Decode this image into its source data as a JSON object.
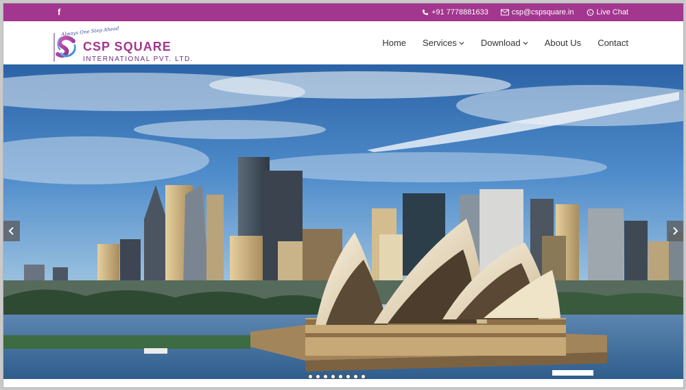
{
  "topbar": {
    "social_icon": "facebook-icon",
    "phone": "+91 7778881633",
    "email": "csp@cspsquare.in",
    "live_chat": "Live Chat",
    "background": "#a3368e"
  },
  "logo": {
    "tagline": "Always One Step Ahead",
    "name": "CSP SQUARE",
    "subtitle": "INTERNATIONAL PVT. LTD."
  },
  "nav": {
    "items": [
      {
        "label": "Home"
      },
      {
        "label": "Services"
      },
      {
        "label": "Download"
      },
      {
        "label": "About Us"
      },
      {
        "label": "Contact"
      }
    ]
  },
  "slider": {
    "slide_count": 8,
    "active_slide": 1,
    "prev_icon": "chevron-left-icon",
    "next_icon": "chevron-right-icon"
  }
}
